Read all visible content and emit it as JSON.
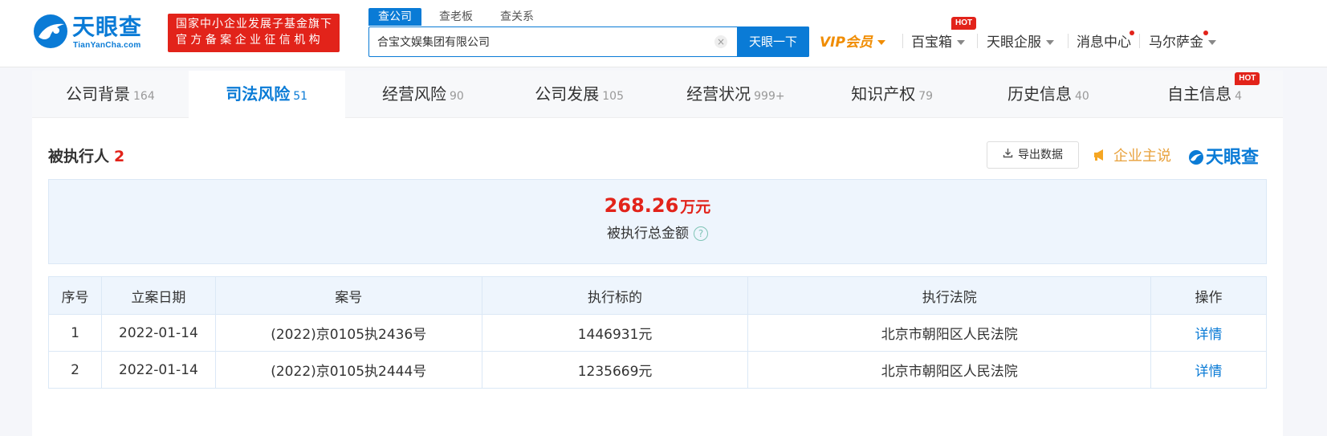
{
  "brand": {
    "name": "天眼查",
    "subname": "TianYanCha.com",
    "gov_badge_line1": "国家中小企业发展子基金旗下",
    "gov_badge_line2": "官方备案企业征信机构",
    "accent": "#0a7bd6",
    "danger": "#e2231a"
  },
  "search": {
    "tabs": [
      "查公司",
      "查老板",
      "查关系"
    ],
    "value": "合宝文娱集团有限公司",
    "clear_icon": "×",
    "button": "天眼一下"
  },
  "nav": {
    "vip": "VIP会员",
    "treasure": "百宝箱",
    "treasure_badge": "HOT",
    "enterprise": "天眼企服",
    "messages": "消息中心",
    "user": "马尔萨金"
  },
  "categories": [
    {
      "label": "公司背景",
      "count": "164"
    },
    {
      "label": "司法风险",
      "count": "51"
    },
    {
      "label": "经营风险",
      "count": "90"
    },
    {
      "label": "公司发展",
      "count": "105"
    },
    {
      "label": "经营状况",
      "count": "999+"
    },
    {
      "label": "知识产权",
      "count": "79"
    },
    {
      "label": "历史信息",
      "count": "40"
    },
    {
      "label": "自主信息",
      "count": "4",
      "badge": "HOT"
    }
  ],
  "section": {
    "title": "被执行人",
    "count": "2",
    "export": "导出数据",
    "corp_voice": "企业主说",
    "brand_mark": "天眼查"
  },
  "summary": {
    "amount": "268.26",
    "unit": "万元",
    "label": "被执行总金额",
    "help": "?"
  },
  "table": {
    "headers": [
      "序号",
      "立案日期",
      "案号",
      "执行标的",
      "执行法院",
      "操作"
    ],
    "rows": [
      {
        "no": "1",
        "date": "2022-01-14",
        "case": "(2022)京0105执2436号",
        "amount": "1446931元",
        "court": "北京市朝阳区人民法院",
        "action": "详情"
      },
      {
        "no": "2",
        "date": "2022-01-14",
        "case": "(2022)京0105执2444号",
        "amount": "1235669元",
        "court": "北京市朝阳区人民法院",
        "action": "详情"
      }
    ]
  }
}
